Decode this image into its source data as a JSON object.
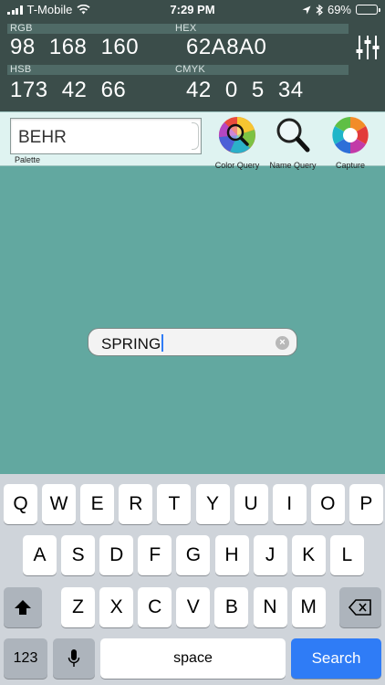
{
  "status_bar": {
    "carrier": "T-Mobile",
    "time": "7:29 PM",
    "battery": "69%",
    "battery_level": 0.69
  },
  "readout": {
    "rgb_label": "RGB",
    "rgb_value": "98 168 160",
    "hex_label": "HEX",
    "hex_value": "62A8A0",
    "hsb_label": "HSB",
    "hsb_value": "173 42 66",
    "cmyk_label": "CMYK",
    "cmyk_value": "42 0 5 34"
  },
  "toolbar": {
    "palette_value": "BEHR",
    "palette_caption": "Palette",
    "color_query_label": "Color Query",
    "name_query_label": "Name Query",
    "capture_label": "Capture"
  },
  "search": {
    "value": "SPRING"
  },
  "keyboard": {
    "row1": [
      "Q",
      "W",
      "E",
      "R",
      "T",
      "Y",
      "U",
      "I",
      "O",
      "P"
    ],
    "row2": [
      "A",
      "S",
      "D",
      "F",
      "G",
      "H",
      "J",
      "K",
      "L"
    ],
    "row3": [
      "Z",
      "X",
      "C",
      "V",
      "B",
      "N",
      "M"
    ],
    "numbers_label": "123",
    "space_label": "space",
    "search_label": "Search"
  },
  "colors": {
    "swatch": "#62A8A0",
    "header_bg": "#3b4d4a",
    "accent_blue": "#2f7cf6"
  },
  "icons": [
    "signal-icon",
    "wifi-icon",
    "location-icon",
    "bluetooth-icon",
    "battery-icon",
    "sliders-icon",
    "color-wheel-icon",
    "magnifier-icon",
    "aperture-icon",
    "clear-icon",
    "shift-icon",
    "backspace-icon",
    "microphone-icon"
  ]
}
